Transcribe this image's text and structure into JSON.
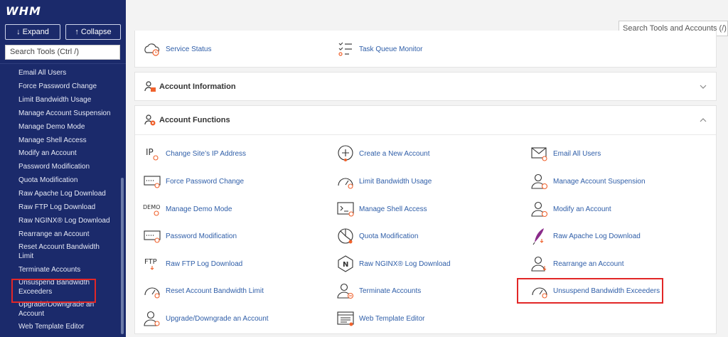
{
  "sidebar": {
    "logo": "WHM",
    "expand_label": "↓ Expand",
    "collapse_label": "↑ Collapse",
    "search_placeholder": "Search Tools (Ctrl /)",
    "items": [
      "Email All Users",
      "Force Password Change",
      "Limit Bandwidth Usage",
      "Manage Account Suspension",
      "Manage Demo Mode",
      "Manage Shell Access",
      "Modify an Account",
      "Password Modification",
      "Quota Modification",
      "Raw Apache Log Download",
      "Raw FTP Log Download",
      "Raw NGINX® Log Download",
      "Rearrange an Account",
      "Reset Account Bandwidth Limit",
      "Terminate Accounts",
      "Unsuspend Bandwidth Exceeders",
      "Upgrade/Downgrade an Account",
      "Web Template Editor"
    ]
  },
  "header": {
    "search_placeholder": "Search Tools and Accounts (/)"
  },
  "top_section": {
    "tools": [
      "Service Status",
      "Task Queue Monitor"
    ]
  },
  "account_information": {
    "title": "Account Information"
  },
  "account_functions": {
    "title": "Account Functions",
    "tools": [
      "Change Site’s IP Address",
      "Create a New Account",
      "Email All Users",
      "Force Password Change",
      "Limit Bandwidth Usage",
      "Manage Account Suspension",
      "Manage Demo Mode",
      "Manage Shell Access",
      "Modify an Account",
      "Password Modification",
      "Quota Modification",
      "Raw Apache Log Download",
      "Raw FTP Log Download",
      "Raw NGINX® Log Download",
      "Rearrange an Account",
      "Reset Account Bandwidth Limit",
      "Terminate Accounts",
      "Unsuspend Bandwidth Exceeders",
      "Upgrade/Downgrade an Account",
      "Web Template Editor"
    ],
    "icon_text": {
      "ip": "IP",
      "demo": "DEMO",
      "ftp": "FTP",
      "nginx": "N"
    }
  },
  "colors": {
    "sidebar_bg": "#1b2a6b",
    "link": "#2f5ea8",
    "accent_orange": "#f0622d",
    "highlight_red": "#e22727"
  }
}
